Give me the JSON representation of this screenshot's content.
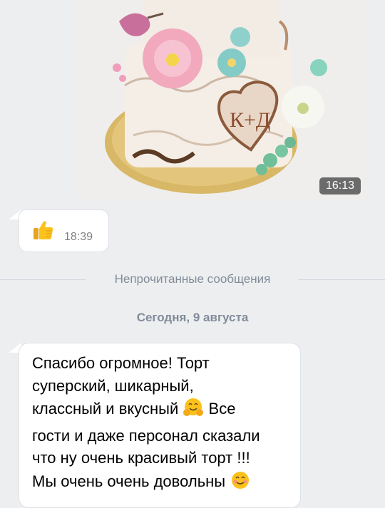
{
  "photo_message": {
    "time": "16:13",
    "cake_monogram": "К+Д"
  },
  "thumbs_message": {
    "emoji": "thumbs-up-emoji",
    "time": "18:39"
  },
  "unread_separator": "Непрочитанные сообщения",
  "date_separator": "Сегодня, 9 августа",
  "text_message": {
    "line1": "Спасибо огромное! Торт",
    "line2": "суперский, шикарный,",
    "line3a": "классный и вкусный",
    "line3b": "Все",
    "line4": "гости и даже персонал сказали",
    "line5": "что ну очень красивый торт !!!",
    "line6": "Мы очень очень довольны",
    "emoji_1": "hugging-face-emoji",
    "emoji_2": "smiling-face-emoji"
  }
}
